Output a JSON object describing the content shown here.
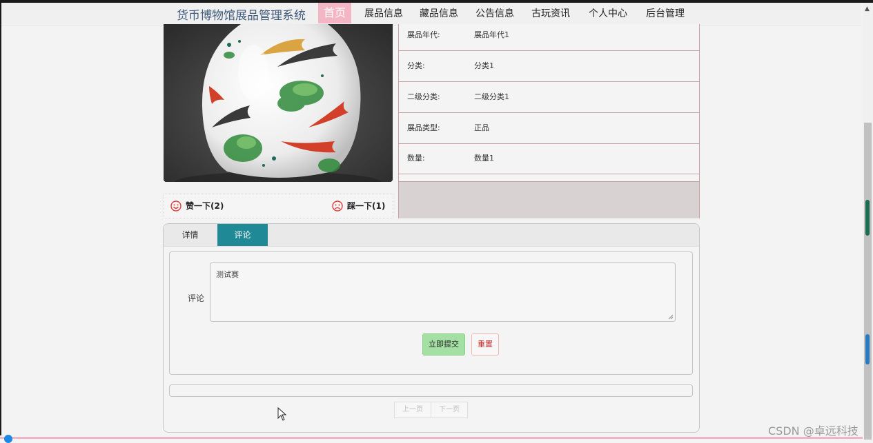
{
  "nav": {
    "site_title": "货币博物馆展品管理系统",
    "items": [
      "首页",
      "展品信息",
      "藏品信息",
      "公告信息",
      "古玩资讯",
      "个人中心",
      "后台管理"
    ],
    "active_index": 0
  },
  "product": {
    "image_icon": "koi-fish-vase-image"
  },
  "likes": {
    "like_label": "赞一下(2)",
    "dislike_label": "踩一下(1)"
  },
  "info": {
    "rows": [
      {
        "label": "展品年代:",
        "value": "展品年代1"
      },
      {
        "label": "分类:",
        "value": "分类1"
      },
      {
        "label": "二级分类:",
        "value": "二级分类1"
      },
      {
        "label": "展品类型:",
        "value": "正品"
      },
      {
        "label": "数量:",
        "value": "数量1"
      }
    ]
  },
  "tabs": {
    "detail": "详情",
    "comment": "评论",
    "active": "comment"
  },
  "comment_form": {
    "label": "评论",
    "value": "测试赛",
    "submit": "立即提交",
    "reset": "重置"
  },
  "pager": {
    "prev": "上一页",
    "next": "下一页"
  },
  "watermark": "CSDN @卓远科技",
  "colors": {
    "nav_active": "#f4b6c4",
    "tab_active": "#1f8a96",
    "submit_button": "#a4e0a4",
    "reset_text": "#c62828",
    "table_border": "#c9a0a6"
  }
}
